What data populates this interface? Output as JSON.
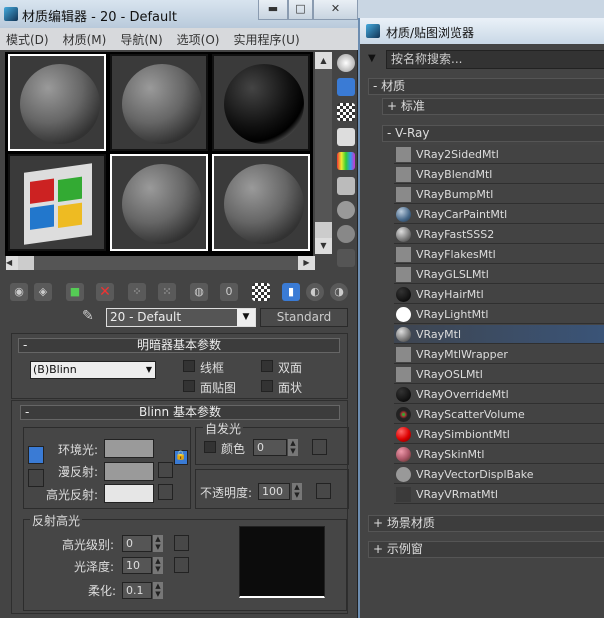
{
  "editor": {
    "title": "材质编辑器 - 20 - Default",
    "menu": [
      "模式(D)",
      "材质(M)",
      "导航(N)",
      "选项(O)",
      "实用程序(U)"
    ],
    "material_name": "20 - Default",
    "material_type": "Standard",
    "shader_rollout": {
      "title": "明暗器基本参数",
      "shader": "(B)Blinn",
      "options": [
        "线框",
        "双面",
        "面贴图",
        "面状"
      ]
    },
    "blinn_rollout": {
      "title": "Blinn 基本参数",
      "ambient_label": "环境光:",
      "diffuse_label": "漫反射:",
      "specular_label": "高光反射:",
      "self_illum": {
        "title": "自发光",
        "color_label": "颜色",
        "value": "0"
      },
      "opacity": {
        "label": "不透明度:",
        "value": "100"
      },
      "spec_highlights": {
        "title": "反射高光",
        "level_label": "高光级别:",
        "level": "0",
        "gloss_label": "光泽度:",
        "gloss": "10",
        "soften_label": "柔化:",
        "soften": "0.1"
      }
    },
    "colors": {
      "ambient": "#9a9a9a",
      "diffuse": "#9a9a9a",
      "specular": "#e6e6e6",
      "accent": "#3a7bd5"
    }
  },
  "browser": {
    "title": "材质/贴图浏览器",
    "search_placeholder": "按名称搜索...",
    "cat_materials": "- 材质",
    "cat_standard": "+ 标准",
    "cat_vray": "- V-Ray",
    "items": [
      {
        "name": "VRay2SidedMtl",
        "icon": "gray-square"
      },
      {
        "name": "VRayBlendMtl",
        "icon": "gray-square"
      },
      {
        "name": "VRayBumpMtl",
        "icon": "gray-square"
      },
      {
        "name": "VRayCarPaintMtl",
        "icon": "blue-sphere"
      },
      {
        "name": "VRayFastSSS2",
        "icon": "gray-sphere"
      },
      {
        "name": "VRayFlakesMtl",
        "icon": "gray-square"
      },
      {
        "name": "VRayGLSLMtl",
        "icon": "gray-square"
      },
      {
        "name": "VRayHairMtl",
        "icon": "black-sphere"
      },
      {
        "name": "VRayLightMtl",
        "icon": "white-sphere"
      },
      {
        "name": "VRayMtl",
        "icon": "gray-sphere",
        "selected": true
      },
      {
        "name": "VRayMtlWrapper",
        "icon": "gray-square"
      },
      {
        "name": "VRayOSLMtl",
        "icon": "gray-square"
      },
      {
        "name": "VRayOverrideMtl",
        "icon": "black-sphere"
      },
      {
        "name": "VRayScatterVolume",
        "icon": "speckled-sphere"
      },
      {
        "name": "VRaySimbiontMtl",
        "icon": "red-sphere"
      },
      {
        "name": "VRaySkinMtl",
        "icon": "skin-sphere"
      },
      {
        "name": "VRayVectorDisplBake",
        "icon": "light-gray-sphere"
      },
      {
        "name": "VRayVRmatMtl",
        "icon": "dark-square"
      }
    ],
    "cat_scene": "+ 场景材质",
    "cat_sample": "+ 示例窗"
  }
}
